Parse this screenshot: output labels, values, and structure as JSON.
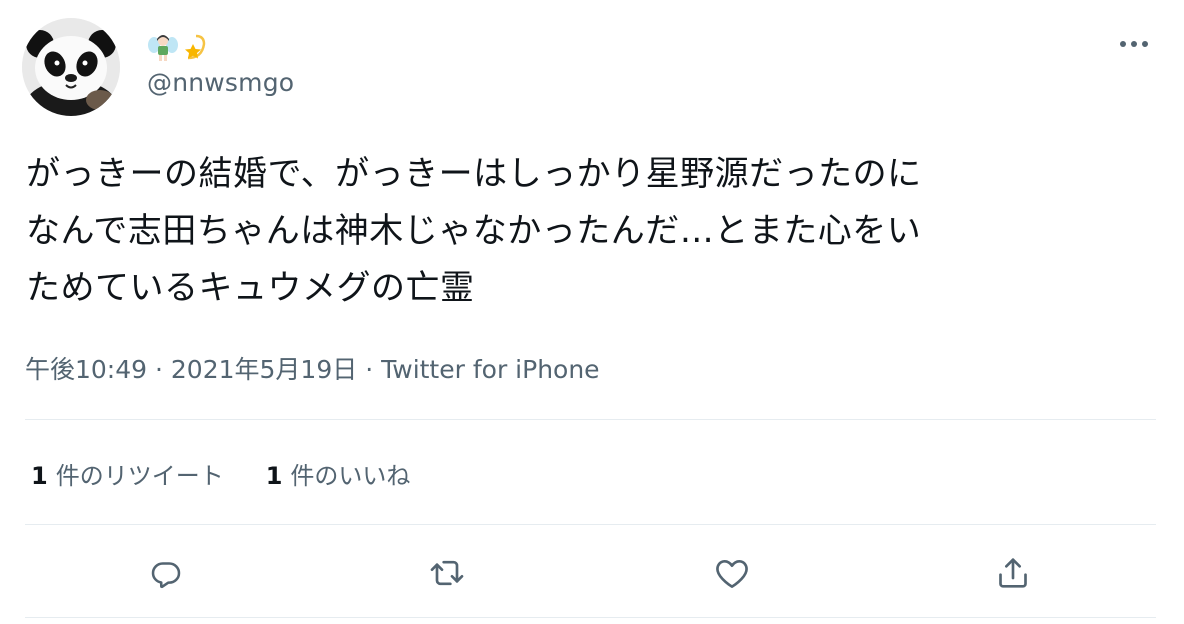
{
  "author": {
    "handle": "@nnwsmgo",
    "display_name_icons": [
      "fairy-emoji-icon",
      "dizzy-star-emoji-icon"
    ]
  },
  "tweet": {
    "text_lines": [
      "がっきーの結婚で、がっきーはしっかり星野源だったのに",
      "なんで志田ちゃんは神木じゃなかったんだ…とまた心をい",
      "ためているキュウメグの亡霊"
    ]
  },
  "meta": {
    "time": "午後10:49",
    "separator": "·",
    "date": "2021年5月19日",
    "source": "Twitter for iPhone"
  },
  "stats": {
    "retweets_count": "1",
    "retweets_label": "件のリツイート",
    "likes_count": "1",
    "likes_label": "件のいいね"
  },
  "colors": {
    "text": "#0f1419",
    "secondary": "#536471",
    "divider": "#e6ecf0"
  },
  "icons": [
    "more-icon",
    "reply-icon",
    "retweet-icon",
    "like-icon",
    "share-icon"
  ]
}
